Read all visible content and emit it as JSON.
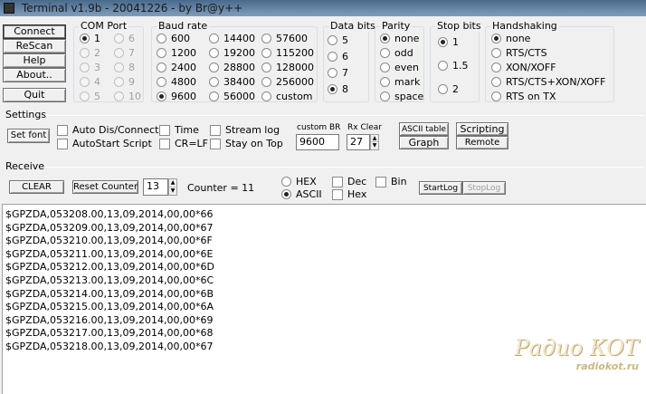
{
  "window": {
    "title": "Terminal v1.9b - 20041226 - by Br@y++"
  },
  "buttons": {
    "connect": "Connect",
    "rescan": "ReScan",
    "help": "Help",
    "about": "About..",
    "quit": "Quit"
  },
  "com_port": {
    "title": "COM Port",
    "options": [
      "1",
      "2",
      "3",
      "4",
      "5",
      "6",
      "7",
      "8",
      "9",
      "10"
    ],
    "selected": "1"
  },
  "baud_rate": {
    "title": "Baud rate",
    "options": [
      "600",
      "1200",
      "2400",
      "4800",
      "9600",
      "14400",
      "19200",
      "28800",
      "38400",
      "56000",
      "57600",
      "115200",
      "128000",
      "256000",
      "custom"
    ],
    "selected": "9600"
  },
  "data_bits": {
    "title": "Data bits",
    "options": [
      "5",
      "6",
      "7",
      "8"
    ],
    "selected": "8"
  },
  "parity": {
    "title": "Parity",
    "options": [
      "none",
      "odd",
      "even",
      "mark",
      "space"
    ],
    "selected": "none"
  },
  "stop_bits": {
    "title": "Stop bits",
    "options": [
      "1",
      "1.5",
      "2"
    ],
    "selected": "1"
  },
  "handshaking": {
    "title": "Handshaking",
    "options": [
      "none",
      "RTS/CTS",
      "XON/XOFF",
      "RTS/CTS+XON/XOFF",
      "RTS on TX"
    ],
    "selected": "none"
  },
  "settings": {
    "title": "Settings",
    "set_font": "Set font",
    "checkboxes": [
      "Auto Dis/Connect",
      "AutoStart Script",
      "Time",
      "CR=LF",
      "Stream log",
      "Stay on Top"
    ],
    "custom_br_label": "custom BR",
    "custom_br_value": "9600",
    "rx_clear_label": "Rx Clear",
    "rx_clear_value": "27",
    "ascii_table": "ASCII table",
    "graph": "Graph",
    "scripting": "Scripting",
    "remote": "Remote"
  },
  "receive": {
    "title": "Receive",
    "clear": "CLEAR",
    "reset_counter": "Reset Counter",
    "counter_spin": "13",
    "counter_label": "Counter = ",
    "counter_value": "11",
    "hex": "HEX",
    "ascii": "ASCII",
    "dec": "Dec",
    "hex_cb": "Hex",
    "bin": "Bin",
    "startlog": "StartLog",
    "stoplog": "StopLog",
    "lines": [
      "$GPZDA,053208.00,13,09,2014,00,00*66",
      "$GPZDA,053209.00,13,09,2014,00,00*67",
      "$GPZDA,053210.00,13,09,2014,00,00*6F",
      "$GPZDA,053211.00,13,09,2014,00,00*6E",
      "$GPZDA,053212.00,13,09,2014,00,00*6D",
      "$GPZDA,053213.00,13,09,2014,00,00*6C",
      "$GPZDA,053214.00,13,09,2014,00,00*6B",
      "$GPZDA,053215.00,13,09,2014,00,00*6A",
      "$GPZDA,053216.00,13,09,2014,00,00*69",
      "$GPZDA,053217.00,13,09,2014,00,00*68",
      "$GPZDA,053218.00,13,09,2014,00,00*67"
    ]
  },
  "watermark": {
    "brand": "Радио КОТ",
    "url": "radiokot.ru"
  }
}
